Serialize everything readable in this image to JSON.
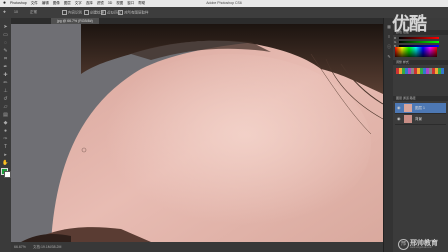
{
  "menubar": {
    "apple": "",
    "items": [
      "Photoshop",
      "文件",
      "编辑",
      "图像",
      "图层",
      "文字",
      "选择",
      "滤镜",
      "3D",
      "视图",
      "窗口",
      "帮助"
    ],
    "title": "Adobe Photoshop CS6",
    "clock": "周三 下午"
  },
  "options": {
    "size": "10",
    "mode": "正常",
    "type1": "内容识别",
    "type2": "创建纹理",
    "type3": "近似匹配",
    "sample": "对所有图层取样"
  },
  "tab": {
    "label": "jpg @ 66.7% (RGB/8#)"
  },
  "watermark_top": "优酷",
  "status": {
    "zoom": "66.67%",
    "doc": "文档:19.1M/38.2M"
  },
  "panels": {
    "color_tab": "颜色 色板",
    "adjust_tab": "调整 样式",
    "layers_tab": "图层 通道 路径",
    "layers": [
      {
        "name": "图层 1"
      },
      {
        "name": "背景"
      }
    ]
  },
  "brand": {
    "name": "邢帅教育",
    "sub": "www.xingshuai.com",
    "logo": "邢"
  },
  "colors": {
    "foreground": "#1e9e3c",
    "background": "#ffffff",
    "accent": "#4d78b4"
  }
}
